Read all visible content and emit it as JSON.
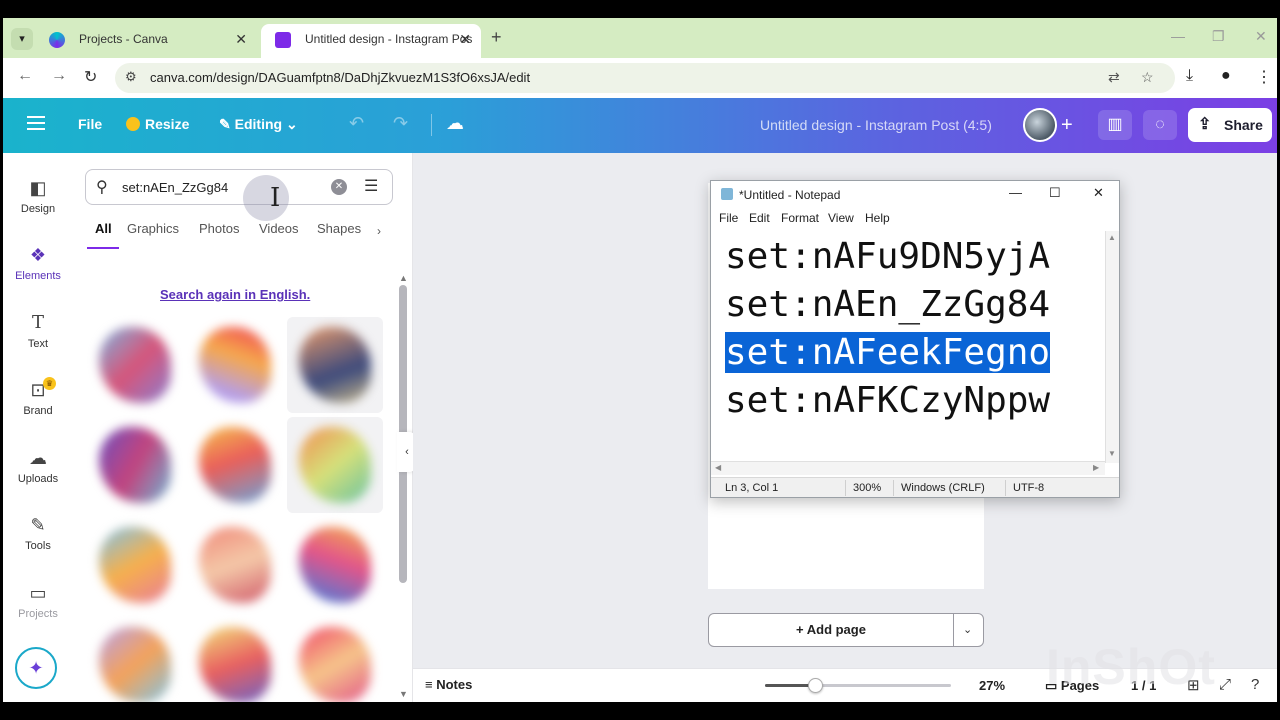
{
  "browser": {
    "tabs": [
      {
        "title": "Projects - Canva",
        "active": false
      },
      {
        "title": "Untitled design - Instagram Pos",
        "active": true
      }
    ],
    "url": "canva.com/design/DAGuamfptn8/DaDhjZkvuezM1S3fO6xsJA/edit"
  },
  "canva_header": {
    "file_label": "File",
    "resize_label": "Resize",
    "editing_label": "Editing",
    "design_title": "Untitled design - Instagram Post (4:5)",
    "share_label": "Share"
  },
  "rail": {
    "items": [
      {
        "label": "Design",
        "icon": "design-icon"
      },
      {
        "label": "Elements",
        "icon": "elements-icon",
        "active": true
      },
      {
        "label": "Text",
        "icon": "text-icon"
      },
      {
        "label": "Brand",
        "icon": "brand-icon"
      },
      {
        "label": "Uploads",
        "icon": "uploads-icon"
      },
      {
        "label": "Tools",
        "icon": "tools-icon"
      },
      {
        "label": "Projects",
        "icon": "projects-icon"
      }
    ]
  },
  "panel": {
    "search_value": "set:nAEn_ZzGg84",
    "filter_tabs": [
      "All",
      "Graphics",
      "Photos",
      "Videos",
      "Shapes"
    ],
    "active_tab": "All",
    "search_again_link": "Search again in English."
  },
  "canvas": {
    "add_page_label": "+ Add page"
  },
  "bottom_bar": {
    "notes_label": "Notes",
    "zoom": "27%",
    "zoom_value": 0.27,
    "pages_label": "Pages",
    "page_count": "1 / 1"
  },
  "notepad": {
    "title": "*Untitled - Notepad",
    "menu": [
      "File",
      "Edit",
      "Format",
      "View",
      "Help"
    ],
    "lines": [
      "set:nAFu9DN5yjA",
      "set:nAEn_ZzGg84",
      "set:nAFeekFegno",
      "set:nAFKCzyNppw"
    ],
    "selected_line": 3,
    "status": {
      "position": "Ln 3, Col 1",
      "zoom": "300%",
      "line_endings": "Windows (CRLF)",
      "encoding": "UTF-8"
    }
  },
  "watermark": "InShOt",
  "colors": {
    "accent": "#7d2ae8",
    "selection": "#0a64d6",
    "header_start": "#1ab3cc",
    "header_end": "#7b3fe4"
  }
}
